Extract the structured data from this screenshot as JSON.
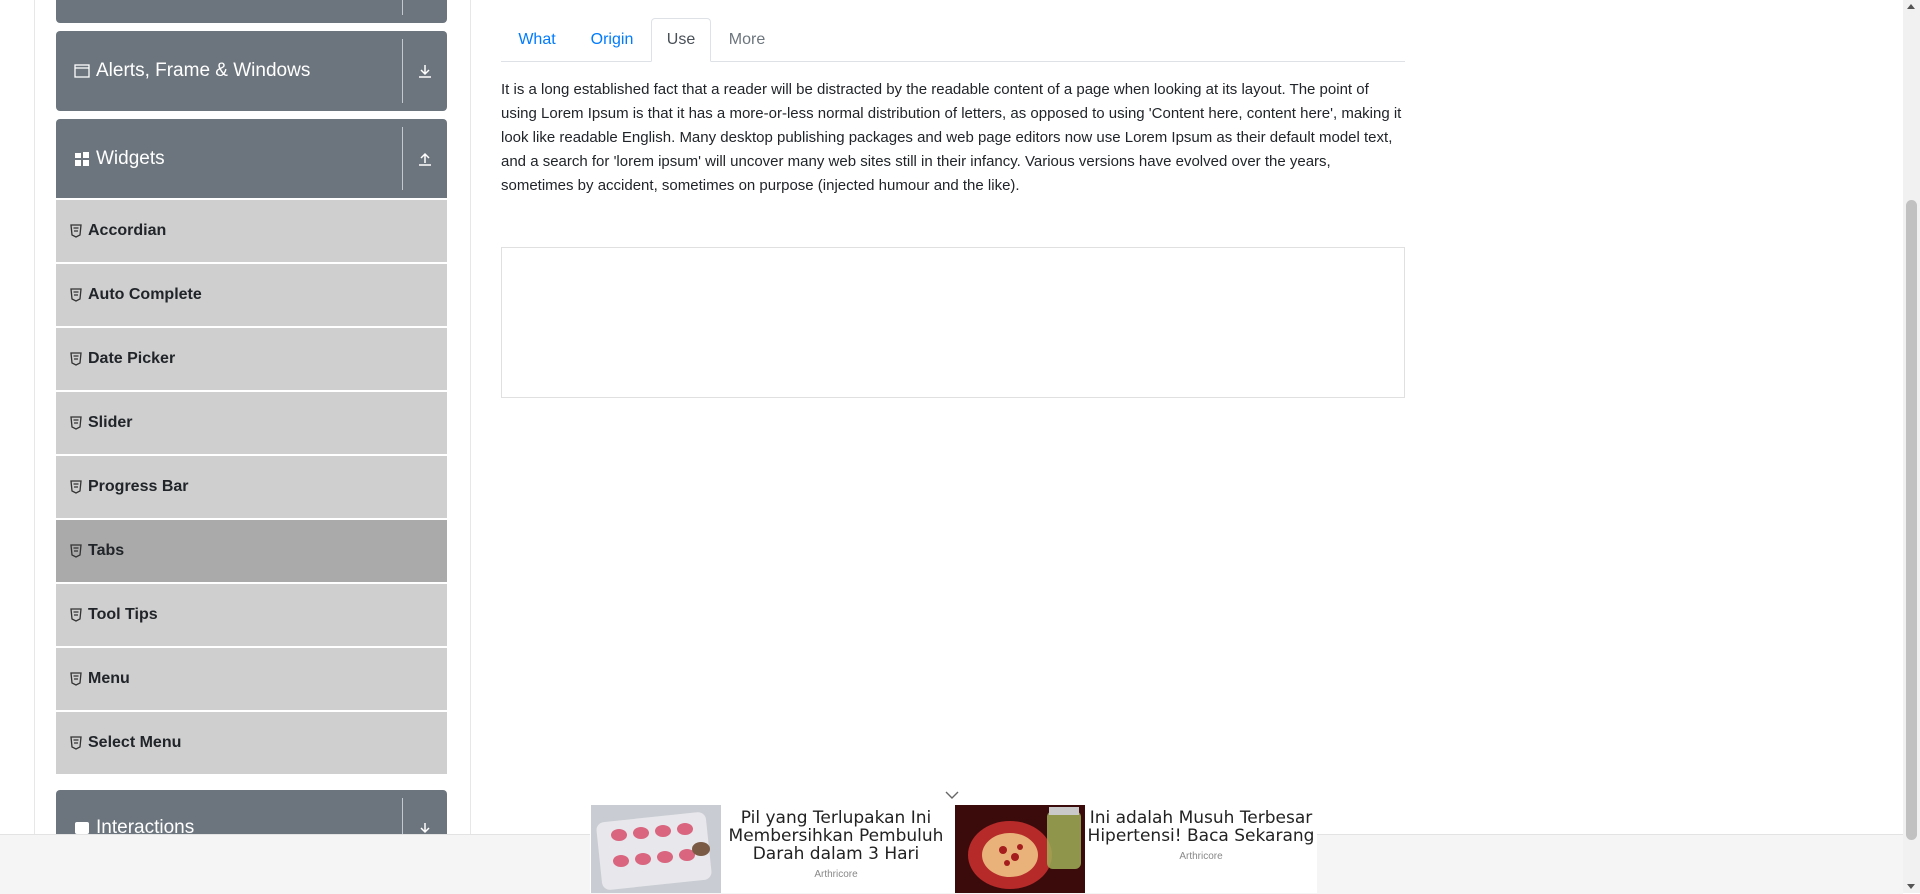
{
  "sidebar": {
    "groups": {
      "alerts": {
        "label": "Alerts, Frame & Windows"
      },
      "widgets": {
        "label": "Widgets"
      },
      "interactions": {
        "label": "Interactions"
      }
    },
    "items": [
      {
        "label": "Accordian"
      },
      {
        "label": "Auto Complete"
      },
      {
        "label": "Date Picker"
      },
      {
        "label": "Slider"
      },
      {
        "label": "Progress Bar"
      },
      {
        "label": "Tabs"
      },
      {
        "label": "Tool Tips"
      },
      {
        "label": "Menu"
      },
      {
        "label": "Select Menu"
      }
    ],
    "active_item": "Tabs"
  },
  "tabs": [
    {
      "label": "What"
    },
    {
      "label": "Origin"
    },
    {
      "label": "Use"
    },
    {
      "label": "More"
    }
  ],
  "active_tab": "Use",
  "tab_content": {
    "text": "It is a long established fact that a reader will be distracted by the readable content of a page when looking at its layout. The point of using Lorem Ipsum is that it has a more-or-less normal distribution of letters, as opposed to using 'Content here, content here', making it look like readable English. Many desktop publishing packages and web page editors now use Lorem Ipsum as their default model text, and a search for 'lorem ipsum' will uncover many web sites still in their infancy. Various versions have evolved over the years, sometimes by accident, sometimes on purpose (injected humour and the like)."
  },
  "ads": [
    {
      "title": "Pil yang Terlupakan Ini Membersihkan Pembuluh Darah dalam 3 Hari",
      "source": "Arthricore"
    },
    {
      "title": "Ini adalah Musuh Terbesar Hipertensi! Baca Sekarang",
      "source": "Arthricore"
    }
  ],
  "colors": {
    "group_header": "#6c757d",
    "menu_item": "#cfcfcf",
    "menu_item_active": "#aaaaaa",
    "link": "#007bff"
  },
  "icons": {
    "alerts": "window-icon",
    "widgets": "grid-icon",
    "item": "html5-icon",
    "expand": "download-icon",
    "collapse": "upload-icon"
  }
}
